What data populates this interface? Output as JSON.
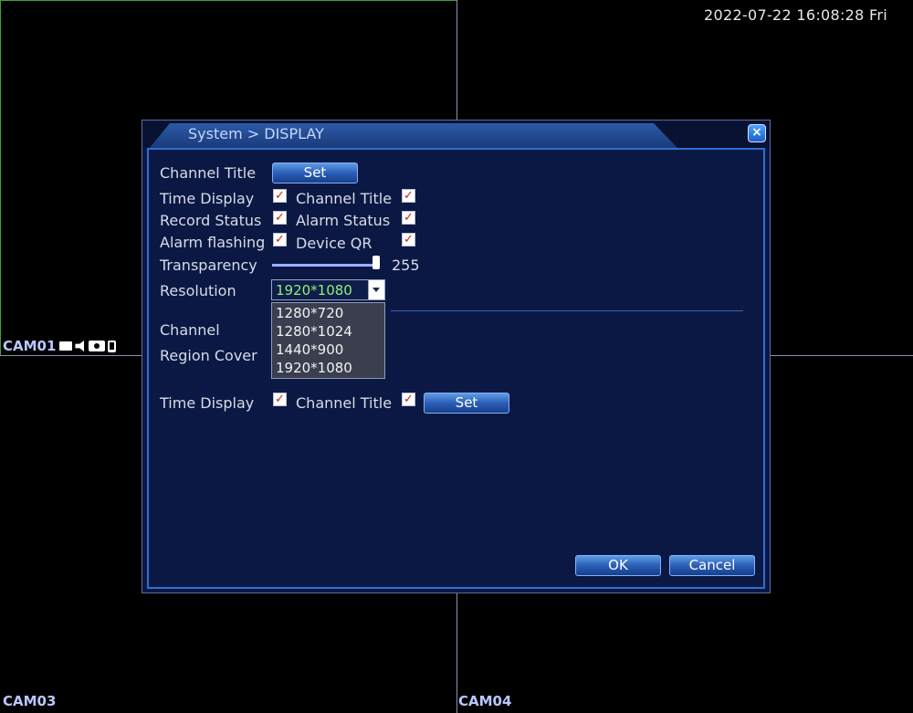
{
  "datetime": "2022-07-22 16:08:28 Fri",
  "cameras": {
    "cam01": "CAM01",
    "cam03": "CAM03",
    "cam04": "CAM04"
  },
  "dialog": {
    "title": "System > DISPLAY",
    "close_glyph": "×",
    "rows": {
      "channel_title_label": "Channel Title",
      "set_label": "Set",
      "time_display_label": "Time Display",
      "channel_title2_label": "Channel Title",
      "record_status_label": "Record Status",
      "alarm_status_label": "Alarm Status",
      "alarm_flashing_label": "Alarm flashing",
      "device_qr_label": "Device QR",
      "transparency_label": "Transparency",
      "transparency_value": "255",
      "resolution_label": "Resolution",
      "resolution_value": "1920*1080",
      "channel_label": "Channel",
      "region_cover_label": "Region Cover",
      "time_display2_label": "Time Display",
      "channel_title3_label": "Channel Title",
      "set2_label": "Set"
    },
    "resolution_options": [
      "1280*720",
      "1280*1024",
      "1440*900",
      "1920*1080"
    ],
    "transparency_level": 1.0,
    "check_glyph": "✓",
    "ok_label": "OK",
    "cancel_label": "Cancel"
  }
}
